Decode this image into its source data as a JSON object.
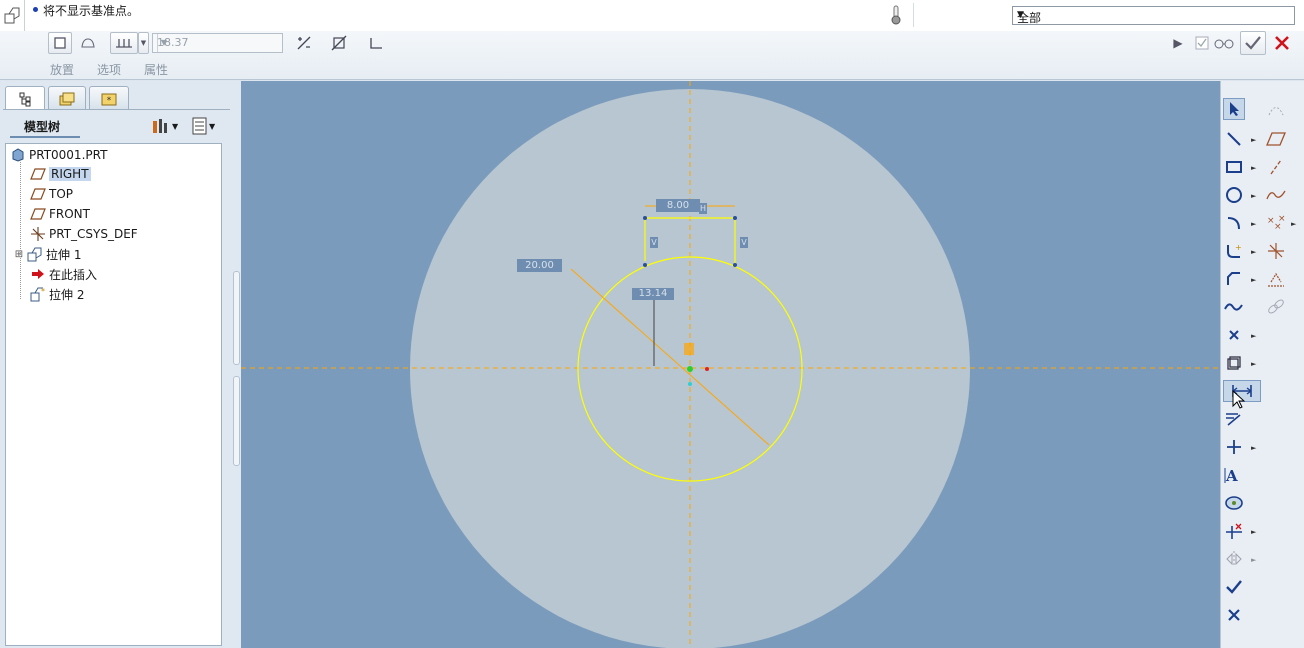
{
  "message_bar": {
    "message": "将不显示基准点。",
    "filter_value": "全部"
  },
  "dashboard": {
    "depth_value": "18.37",
    "tabs": [
      "放置",
      "选项",
      "属性"
    ]
  },
  "navigator": {
    "panel_title": "模型树",
    "tree": [
      {
        "label": "PRT0001.PRT",
        "icon": "part-icon"
      },
      {
        "label": "RIGHT",
        "icon": "datum-plane-icon",
        "selected": true
      },
      {
        "label": "TOP",
        "icon": "datum-plane-icon"
      },
      {
        "label": "FRONT",
        "icon": "datum-plane-icon"
      },
      {
        "label": "PRT_CSYS_DEF",
        "icon": "csys-icon"
      },
      {
        "label": "拉伸 1",
        "icon": "extrude-icon"
      },
      {
        "label": "在此插入",
        "icon": "insert-here-icon"
      },
      {
        "label": "拉伸 2",
        "icon": "extrude-icon"
      }
    ]
  },
  "sketch": {
    "dim_top": "8.00",
    "dim_diameter": "20.00",
    "dim_vertical": "13.14",
    "constraint_h": "H",
    "constraint_v": "V",
    "colors": {
      "background": "#7b9bbd",
      "plane": "#b7c6d0",
      "geometry": "#ffff00",
      "centerline": "#ffa500",
      "dim_box": "#6f8db0"
    }
  },
  "right_toolbar": {
    "icons": [
      "select-arrow-icon",
      "line-icon",
      "rectangle-icon",
      "circle-icon",
      "arc-icon",
      "fillet-icon",
      "chamfer-icon",
      "spline-icon",
      "point-icon",
      "offset-icon",
      "dimension-icon",
      "modify-icon",
      "constraint-icon",
      "text-icon",
      "palette-icon",
      "trim-icon",
      "mirror-icon",
      "accept-check-icon",
      "cancel-x-icon"
    ]
  }
}
